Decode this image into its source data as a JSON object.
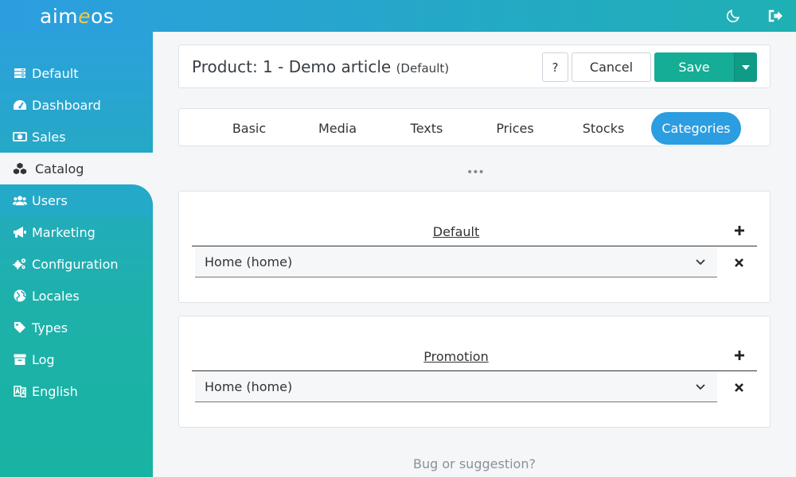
{
  "header": {
    "logo_pre": "aim",
    "logo_e": "e",
    "logo_post": "os",
    "icons": [
      "moon-icon",
      "logout-icon"
    ]
  },
  "sidebar": {
    "items": [
      {
        "label": "Default",
        "icon": "server-icon"
      },
      {
        "label": "Dashboard",
        "icon": "dashboard-icon"
      },
      {
        "label": "Sales",
        "icon": "money-icon"
      },
      {
        "label": "Catalog",
        "icon": "cubes-icon"
      },
      {
        "label": "Users",
        "icon": "users-icon"
      },
      {
        "label": "Marketing",
        "icon": "bullhorn-icon"
      },
      {
        "label": "Configuration",
        "icon": "cogs-icon"
      },
      {
        "label": "Locales",
        "icon": "globe-icon"
      },
      {
        "label": "Types",
        "icon": "tag-icon"
      },
      {
        "label": "Log",
        "icon": "archive-icon"
      },
      {
        "label": "English",
        "icon": "language-icon"
      }
    ],
    "active": "Catalog"
  },
  "toolbar": {
    "title": "Product: 1 - Demo article",
    "subtitle": "(Default)",
    "help_label": "?",
    "cancel_label": "Cancel",
    "save_label": "Save"
  },
  "tabs": [
    {
      "label": "Basic"
    },
    {
      "label": "Media"
    },
    {
      "label": "Texts"
    },
    {
      "label": "Prices"
    },
    {
      "label": "Stocks"
    },
    {
      "label": "Categories"
    }
  ],
  "active_tab": "Categories",
  "more_label": "•••",
  "sections": [
    {
      "title": "Default",
      "selected": "Home (home)"
    },
    {
      "title": "Promotion",
      "selected": "Home (home)"
    }
  ],
  "footer": {
    "link": "Bug or suggestion?"
  },
  "colors": {
    "accent": "#2b9de0",
    "save": "#15ad96",
    "sidebar_top": "#2ba1dc",
    "sidebar_bottom": "#18b3a2"
  }
}
